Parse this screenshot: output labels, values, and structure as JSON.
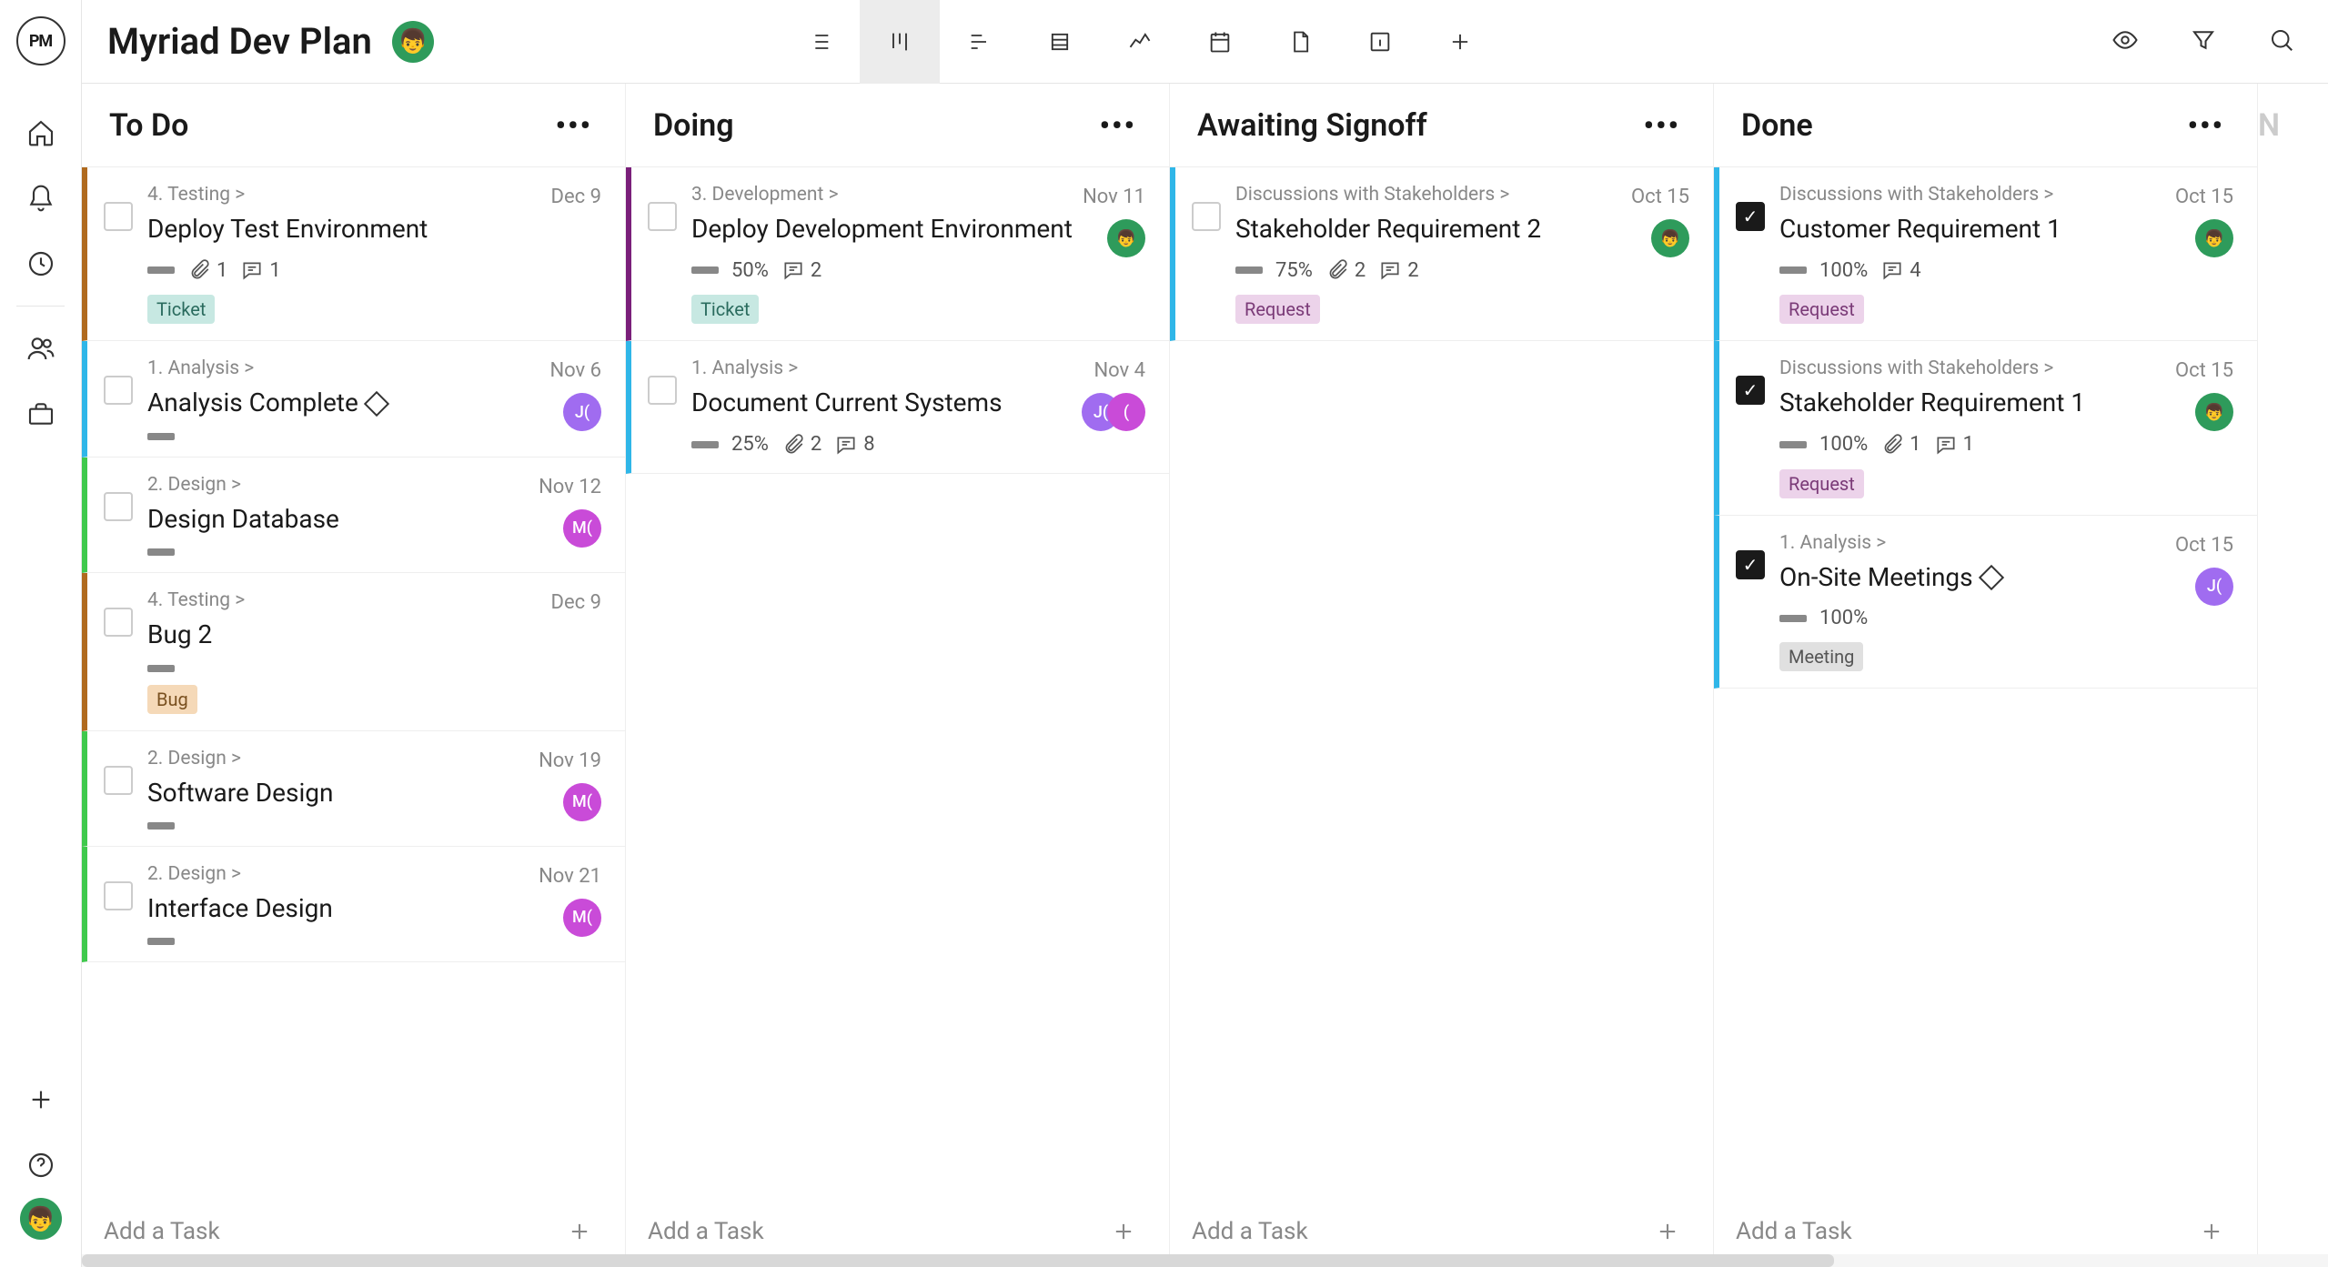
{
  "app": {
    "logo": "PM",
    "project_title": "Myriad Dev Plan"
  },
  "toolbar": {
    "views": [
      "list",
      "board",
      "gantt",
      "table",
      "chart",
      "calendar",
      "doc",
      "panel",
      "add"
    ]
  },
  "columns": [
    {
      "title": "To Do",
      "add_label": "Add a Task",
      "cards": [
        {
          "breadcrumb": "4. Testing >",
          "title": "Deploy Test Environment",
          "date": "Dec 9",
          "stripe": "#b06a1e",
          "progress": "",
          "attachments": 1,
          "comments": 1,
          "tag": "Ticket",
          "tag_class": "ticket",
          "checked": false,
          "avatars": [],
          "diamond": false
        },
        {
          "breadcrumb": "1. Analysis >",
          "title": "Analysis Complete",
          "date": "Nov 6",
          "stripe": "#2fb6e8",
          "progress": "",
          "attachments": null,
          "comments": null,
          "tag": "",
          "tag_class": "",
          "checked": false,
          "avatars": [
            {
              "cls": "purple",
              "txt": "J("
            }
          ],
          "diamond": true
        },
        {
          "breadcrumb": "2. Design >",
          "title": "Design Database",
          "date": "Nov 12",
          "stripe": "#3fc94c",
          "progress": "",
          "attachments": null,
          "comments": null,
          "tag": "",
          "tag_class": "",
          "checked": false,
          "avatars": [
            {
              "cls": "magenta",
              "txt": "M("
            }
          ],
          "diamond": false
        },
        {
          "breadcrumb": "4. Testing >",
          "title": "Bug 2",
          "date": "Dec 9",
          "stripe": "#b06a1e",
          "progress": "",
          "attachments": null,
          "comments": null,
          "tag": "Bug",
          "tag_class": "bug",
          "checked": false,
          "avatars": [],
          "diamond": false
        },
        {
          "breadcrumb": "2. Design >",
          "title": "Software Design",
          "date": "Nov 19",
          "stripe": "#3fc94c",
          "progress": "",
          "attachments": null,
          "comments": null,
          "tag": "",
          "tag_class": "",
          "checked": false,
          "avatars": [
            {
              "cls": "magenta",
              "txt": "M("
            }
          ],
          "diamond": false
        },
        {
          "breadcrumb": "2. Design >",
          "title": "Interface Design",
          "date": "Nov 21",
          "stripe": "#3fc94c",
          "progress": "",
          "attachments": null,
          "comments": null,
          "tag": "",
          "tag_class": "",
          "checked": false,
          "avatars": [
            {
              "cls": "magenta",
              "txt": "M("
            }
          ],
          "diamond": false
        }
      ]
    },
    {
      "title": "Doing",
      "add_label": "Add a Task",
      "cards": [
        {
          "breadcrumb": "3. Development >",
          "title": "Deploy Development Environment",
          "date": "Nov 11",
          "stripe": "#7a1f7a",
          "progress": "50%",
          "attachments": null,
          "comments": 2,
          "tag": "Ticket",
          "tag_class": "ticket",
          "checked": false,
          "avatars": [
            {
              "cls": "green",
              "txt": "👦"
            }
          ],
          "diamond": false
        },
        {
          "breadcrumb": "1. Analysis >",
          "title": "Document Current Systems",
          "date": "Nov 4",
          "stripe": "#2fb6e8",
          "progress": "25%",
          "attachments": 2,
          "comments": 8,
          "tag": "",
          "tag_class": "",
          "checked": false,
          "avatars": [
            {
              "cls": "purple",
              "txt": "J("
            },
            {
              "cls": "magenta",
              "txt": "("
            }
          ],
          "diamond": false
        }
      ]
    },
    {
      "title": "Awaiting Signoff",
      "add_label": "Add a Task",
      "cards": [
        {
          "breadcrumb": "Discussions with Stakeholders >",
          "title": "Stakeholder Requirement 2",
          "date": "Oct 15",
          "stripe": "#2fb6e8",
          "progress": "75%",
          "attachments": 2,
          "comments": 2,
          "tag": "Request",
          "tag_class": "request",
          "checked": false,
          "avatars": [
            {
              "cls": "green",
              "txt": "👦"
            }
          ],
          "diamond": false
        }
      ]
    },
    {
      "title": "Done",
      "add_label": "Add a Task",
      "cards": [
        {
          "breadcrumb": "Discussions with Stakeholders >",
          "title": "Customer Requirement 1",
          "date": "Oct 15",
          "stripe": "#2fb6e8",
          "progress": "100%",
          "attachments": null,
          "comments": 4,
          "tag": "Request",
          "tag_class": "request",
          "checked": true,
          "avatars": [
            {
              "cls": "green",
              "txt": "👦"
            }
          ],
          "diamond": false
        },
        {
          "breadcrumb": "Discussions with Stakeholders >",
          "title": "Stakeholder Requirement 1",
          "date": "Oct 15",
          "stripe": "#2fb6e8",
          "progress": "100%",
          "attachments": 1,
          "comments": 1,
          "tag": "Request",
          "tag_class": "request",
          "checked": true,
          "avatars": [
            {
              "cls": "green",
              "txt": "👦"
            }
          ],
          "diamond": false
        },
        {
          "breadcrumb": "1. Analysis >",
          "title": "On-Site Meetings",
          "date": "Oct 15",
          "stripe": "#2fb6e8",
          "progress": "100%",
          "attachments": null,
          "comments": null,
          "tag": "Meeting",
          "tag_class": "meeting",
          "checked": true,
          "avatars": [
            {
              "cls": "purple",
              "txt": "J("
            }
          ],
          "diamond": true
        }
      ]
    }
  ],
  "next_col_hint": "N"
}
